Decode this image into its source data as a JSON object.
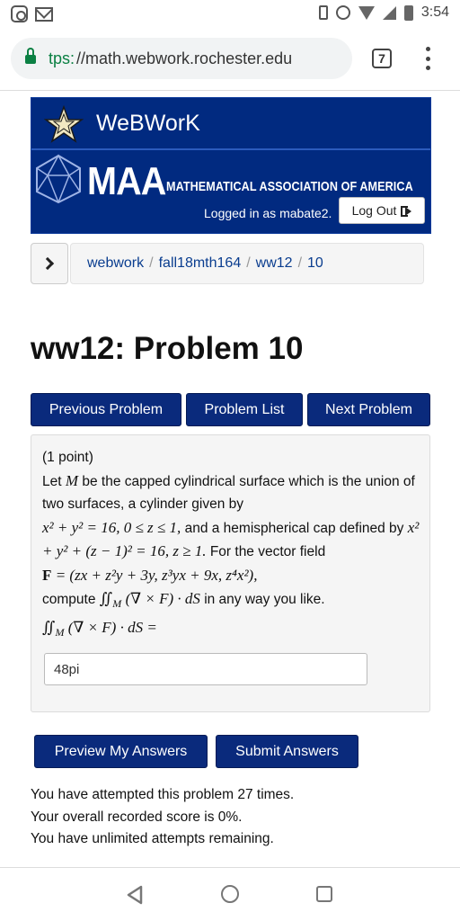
{
  "status_bar": {
    "time": "3:54",
    "icons": [
      "instagram-icon",
      "gmail-icon",
      "vibrate-icon",
      "alarm-icon",
      "wifi-icon",
      "signal-icon",
      "battery-icon"
    ]
  },
  "browser": {
    "url_scheme": "tps:",
    "url_rest": "//math.webwork.rochester.edu",
    "tab_count": "7",
    "secure_color": "#0b8043"
  },
  "header": {
    "app_name": "WeBWorK",
    "org_abbrev": "MAA",
    "org_name": "MATHEMATICAL ASSOCIATION OF AMERICA",
    "logged_in_text": "Logged in as mabate2.",
    "logout_label": "Log Out",
    "banner_color": "#012a80"
  },
  "breadcrumb": {
    "items": [
      "webwork",
      "fall18mth164",
      "ww12",
      "10"
    ],
    "separator": "/"
  },
  "page": {
    "title": "ww12: Problem 10"
  },
  "nav_buttons": {
    "previous": "Previous Problem",
    "list": "Problem List",
    "next": "Next Problem"
  },
  "problem": {
    "points": "(1 point)",
    "intro_1": "Let",
    "var_M": "M",
    "intro_2": "be the capped cylindrical surface which is the union of two surfaces, a cylinder given by",
    "cyl_eq": "x² + y² = 16,  0 ≤ z ≤ 1,",
    "intro_3": "and a hemispherical cap defined by",
    "cap_eq": "x² + y² + (z − 1)² = 16,  z ≥ 1.",
    "intro_4": "For the vector field",
    "field_F": "F",
    "field_def": "= (zx + z²y + 3y,  z³yx + 9x,  z⁴x²),",
    "compute_1": "compute",
    "integral_expr": "∬",
    "integral_sub": "M",
    "integral_body": "(∇ × F) · dS",
    "compute_2": "in any way you like.",
    "answer_lhs": "(∇ × F) · dS =",
    "answer_value": "48pi"
  },
  "actions": {
    "preview": "Preview My Answers",
    "submit": "Submit Answers"
  },
  "attempts": {
    "line1": "You have attempted this problem 27 times.",
    "line2": "Your overall recorded score is 0%.",
    "line3": "You have unlimited attempts remaining."
  },
  "android_nav": {
    "icons": [
      "back-icon",
      "home-icon",
      "recents-icon"
    ]
  }
}
